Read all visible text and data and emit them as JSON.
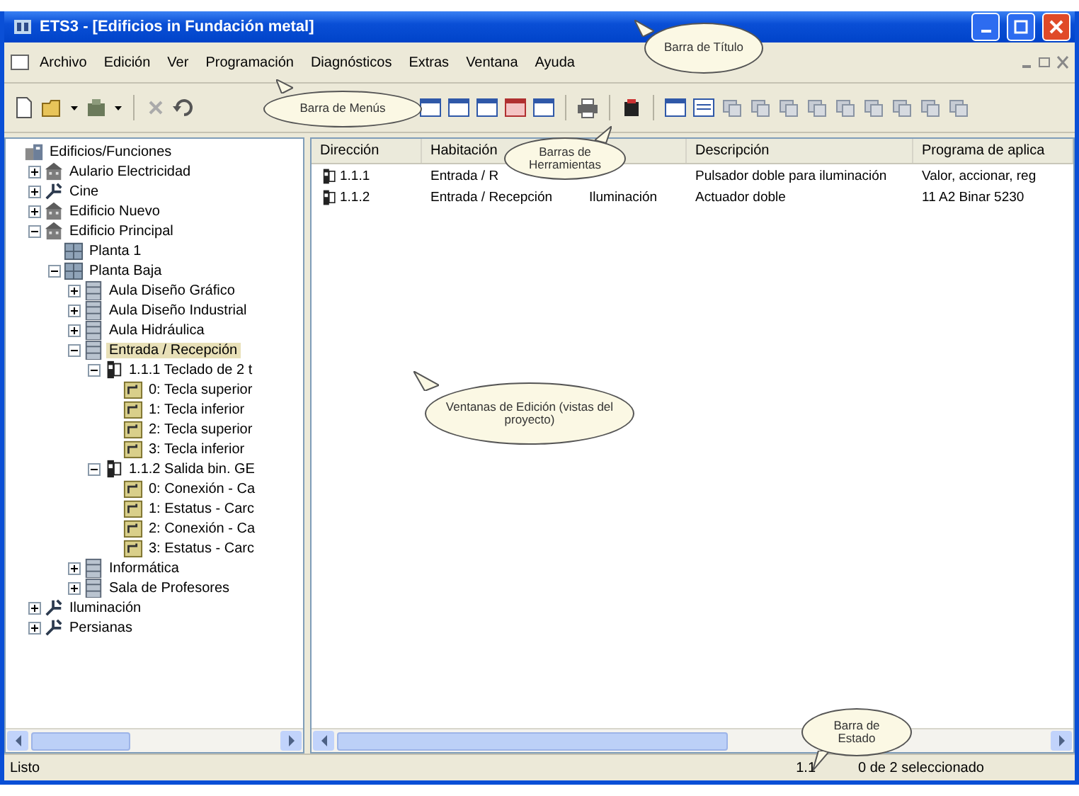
{
  "window": {
    "title": "ETS3 - [Edificios in Fundación metal]"
  },
  "menu": [
    "Archivo",
    "Edición",
    "Ver",
    "Programación",
    "Diagnósticos",
    "Extras",
    "Ventana",
    "Ayuda"
  ],
  "tree": [
    {
      "label": "Edificios/Funciones",
      "kind": "root",
      "selected": false,
      "children": [
        {
          "label": "Aulario Electricidad",
          "kind": "building",
          "expanded": false,
          "selected": false
        },
        {
          "label": "Cine",
          "kind": "function",
          "expanded": false,
          "selected": false
        },
        {
          "label": "Edificio Nuevo",
          "kind": "building",
          "expanded": false,
          "selected": false
        },
        {
          "label": "Edificio Principal",
          "kind": "building",
          "expanded": true,
          "selected": false,
          "children": [
            {
              "label": "Planta 1",
              "kind": "floor",
              "selected": false
            },
            {
              "label": "Planta Baja",
              "kind": "floor",
              "expanded": true,
              "selected": false,
              "children": [
                {
                  "label": "Aula Diseño Gráfico",
                  "kind": "room",
                  "expanded": false,
                  "selected": false
                },
                {
                  "label": "Aula Diseño Industrial",
                  "kind": "room",
                  "expanded": false,
                  "selected": false
                },
                {
                  "label": "Aula Hidráulica",
                  "kind": "room",
                  "expanded": false,
                  "selected": false
                },
                {
                  "label": "Entrada / Recepción",
                  "kind": "room",
                  "expanded": true,
                  "selected": true,
                  "children": [
                    {
                      "label": "1.1.1 Teclado de 2 t",
                      "kind": "device",
                      "expanded": true,
                      "selected": false,
                      "children": [
                        {
                          "label": "0: Tecla superior",
                          "kind": "object",
                          "selected": false
                        },
                        {
                          "label": "1: Tecla inferior",
                          "kind": "object",
                          "selected": false
                        },
                        {
                          "label": "2: Tecla superior",
                          "kind": "object",
                          "selected": false
                        },
                        {
                          "label": "3: Tecla inferior",
                          "kind": "object",
                          "selected": false
                        }
                      ]
                    },
                    {
                      "label": "1.1.2 Salida bin. GE",
                      "kind": "device",
                      "expanded": true,
                      "selected": false,
                      "children": [
                        {
                          "label": "0: Conexión - Ca",
                          "kind": "object",
                          "selected": false
                        },
                        {
                          "label": "1: Estatus - Carc",
                          "kind": "object",
                          "selected": false
                        },
                        {
                          "label": "2: Conexión - Ca",
                          "kind": "object",
                          "selected": false
                        },
                        {
                          "label": "3: Estatus - Carc",
                          "kind": "object",
                          "selected": false
                        }
                      ]
                    }
                  ]
                },
                {
                  "label": "Informática",
                  "kind": "room",
                  "expanded": false,
                  "selected": false
                },
                {
                  "label": "Sala de Profesores",
                  "kind": "room",
                  "expanded": false,
                  "selected": false
                }
              ]
            }
          ]
        },
        {
          "label": "Iluminación",
          "kind": "function",
          "expanded": false,
          "selected": false
        },
        {
          "label": "Persianas",
          "kind": "function",
          "expanded": false,
          "selected": false
        }
      ]
    }
  ],
  "table": {
    "columns": [
      "Dirección",
      "Habitación",
      "Descripción",
      "Programa de aplica"
    ],
    "rows": [
      {
        "direccion": "1.1.1",
        "habitacion": "Entrada / R",
        "descripcion": "Pulsador doble para iluminación",
        "programa": "Valor, accionar, reg"
      },
      {
        "direccion": "1.1.2",
        "habitacion": "Entrada / Recepción",
        "column_3": "Iluminación",
        "descripcion": "Actuador doble",
        "programa": "11 A2 Binar  5230"
      }
    ]
  },
  "status_bar": {
    "message": "Listo",
    "address": "1.1",
    "selection": "0 de 2 seleccionado"
  },
  "callouts": [
    "Barra de Título",
    "Barra de Menús",
    "Barras de Herramientas",
    "Ventanas de Edición (vistas del proyecto)",
    "Barra de Estado"
  ]
}
